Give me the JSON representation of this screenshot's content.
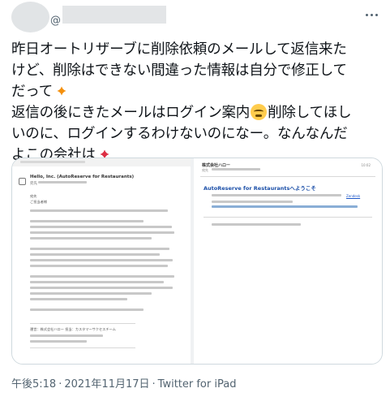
{
  "tweet": {
    "handle_prefix": "@",
    "lines": [
      "昨日オートリザーブに削除依頼のメールして返信来た",
      "けど、削除はできない間違った情報は自分で修正して",
      "だって",
      "返信の後にきたメールはログイン案内",
      "削除してほし",
      "いのに、ログインするわけないのになー。なんなんだ",
      "よこの会社は"
    ],
    "emoji": [
      "anger-symbol-icon",
      "steam-from-nose-face-icon",
      "anger-symbol-icon"
    ],
    "timestamp": "午後5:18",
    "date": "2021年11月17日",
    "separator": "·",
    "source": "Twitter for iPad"
  },
  "media": {
    "left_email": {
      "from": "Hello, Inc. (AutoReserve for Restaurants)",
      "to": "宛先",
      "greeting": "ご担当者様",
      "signature": "運営：株式会社ハロー 担当：カスタマーサクセスチーム"
    },
    "right_email": {
      "company": "株式会社ハロー",
      "address": "宛先",
      "time": "10:02",
      "title": "AutoReserve for Restaurantsへようこそ",
      "link_text": "Zendesk"
    }
  },
  "colors": {
    "text": "#0f1419",
    "muted": "#536471",
    "border": "#cfd9de",
    "link_blue": "#1b4fa8"
  }
}
